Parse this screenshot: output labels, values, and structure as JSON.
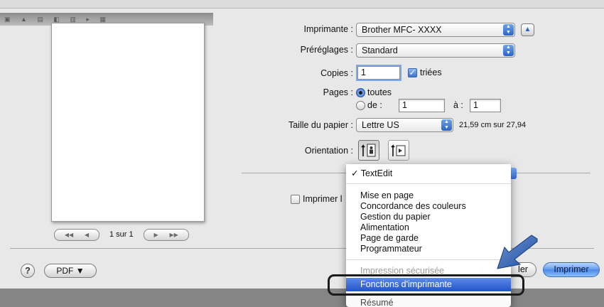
{
  "background_strip": {
    "icons": "▣ ▲ ▤ ◧ ▥ ▸ ▦"
  },
  "preview": {
    "pager": {
      "label": "1 sur 1"
    }
  },
  "printer": {
    "label": "Imprimante :",
    "value": "Brother MFC- XXXX"
  },
  "presets": {
    "label": "Préréglages :",
    "value": "Standard"
  },
  "copies": {
    "label": "Copies :",
    "value": "1",
    "collated_label": "triées",
    "collated_checked": true
  },
  "pages": {
    "label": "Pages :",
    "all_label": "toutes",
    "from_label": "de :",
    "from_value": "1",
    "to_label": "à :",
    "to_value": "1",
    "selected": "toutes"
  },
  "paper": {
    "label": "Taille du papier :",
    "value": "Lettre US",
    "dimensions": "21,59 cm sur 27,94"
  },
  "orientation": {
    "label": "Orientation :",
    "selected": "portrait"
  },
  "print_headers": {
    "label": "Imprimer l"
  },
  "panel_menu": {
    "checked_item": "TextEdit",
    "items": [
      "Mise en page",
      "Concordance des couleurs",
      "Gestion du papier",
      "Alimentation",
      "Page de garde",
      "Programmateur"
    ],
    "faded_item": "Impression sécurisée",
    "highlighted_item": "Fonctions d'imprimante",
    "last_item": "Résumé"
  },
  "footer": {
    "help_label": "?",
    "pdf_label": "PDF ▼",
    "cancel_label": "ler",
    "print_label": "Imprimer"
  },
  "colors": {
    "accent": "#2453c9",
    "highlight_ring": "#1b1b1b",
    "arrow": "#2a5fb5"
  }
}
